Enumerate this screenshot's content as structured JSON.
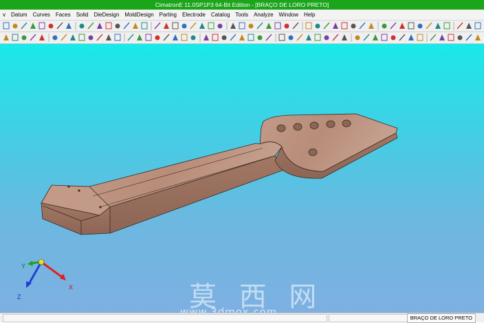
{
  "window": {
    "title": "CimatronE 11.0SP1P3 64-Bit Edition - [BRAÇO DE LORO PRETO]"
  },
  "menu": [
    "v",
    "Datum",
    "Curves",
    "Faces",
    "Solid",
    "DieDesign",
    "MoldDesign",
    "Parting",
    "Electrode",
    "Catalog",
    "Tools",
    "Analyze",
    "Window",
    "Help"
  ],
  "axes": {
    "x": "X",
    "y": "Y",
    "z": "Z"
  },
  "status": {
    "document": "BRAÇO DE LORO PRETO"
  },
  "watermark": {
    "text": "莫 西 网",
    "url": "www.3dmox.com"
  },
  "colors": {
    "titlebar": "#1ba51b",
    "viewport_top": "#19e9e9",
    "viewport_bottom": "#7eb0e2",
    "model": "#b58a76",
    "axis_x": "#e02020",
    "axis_y": "#20a020",
    "axis_z": "#2040d0"
  }
}
